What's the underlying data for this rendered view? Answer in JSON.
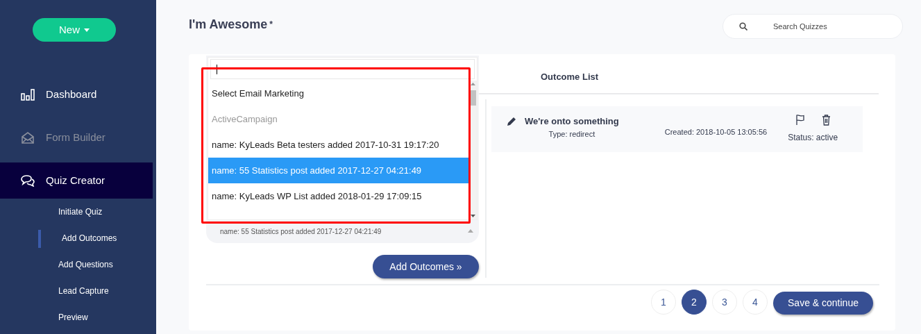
{
  "sidebar": {
    "new_button": "New",
    "items": [
      {
        "label": "Dashboard",
        "selected": false,
        "disabled": false
      },
      {
        "label": "Form Builder",
        "selected": false,
        "disabled": true
      },
      {
        "label": "Quiz Creator",
        "selected": true,
        "disabled": false,
        "children": [
          {
            "label": "Initiate Quiz",
            "selected": false
          },
          {
            "label": "Add Outcomes",
            "selected": true
          },
          {
            "label": "Add Questions",
            "selected": false
          },
          {
            "label": "Lead Capture",
            "selected": false
          },
          {
            "label": "Preview",
            "selected": false
          }
        ]
      }
    ]
  },
  "header": {
    "title": "I'm Awesome",
    "required_mark": "*",
    "search": {
      "placeholder": "Search Quizzes"
    }
  },
  "outcome_select": {
    "options": [
      {
        "kind": "header",
        "label": "Select Email Marketing",
        "selected": false
      },
      {
        "kind": "group",
        "label": "ActiveCampaign",
        "selected": false
      },
      {
        "kind": "option",
        "label": "name: KyLeads Beta testers added 2017-10-31 19:17:20",
        "selected": false
      },
      {
        "kind": "option",
        "label": "name: 55 Statistics post added 2017-12-27 04:21:49",
        "selected": true
      },
      {
        "kind": "option",
        "label": "name: KyLeads WP List added 2018-01-29 17:09:15",
        "selected": false
      }
    ],
    "value": "name: 55 Statistics post added 2017-12-27 04:21:49",
    "add_button": "Add Outcomes »"
  },
  "outcome_list": {
    "title": "Outcome List",
    "items": [
      {
        "name": "We're onto something",
        "type": "Type: redirect",
        "created": "Created: 2018-10-05 13:05:56",
        "status": "Status: active"
      }
    ]
  },
  "pagination": [
    {
      "label": "1",
      "selected": false
    },
    {
      "label": "2",
      "selected": true
    },
    {
      "label": "3",
      "selected": false
    },
    {
      "label": "4",
      "selected": false
    }
  ],
  "save_button": "Save & continue"
}
